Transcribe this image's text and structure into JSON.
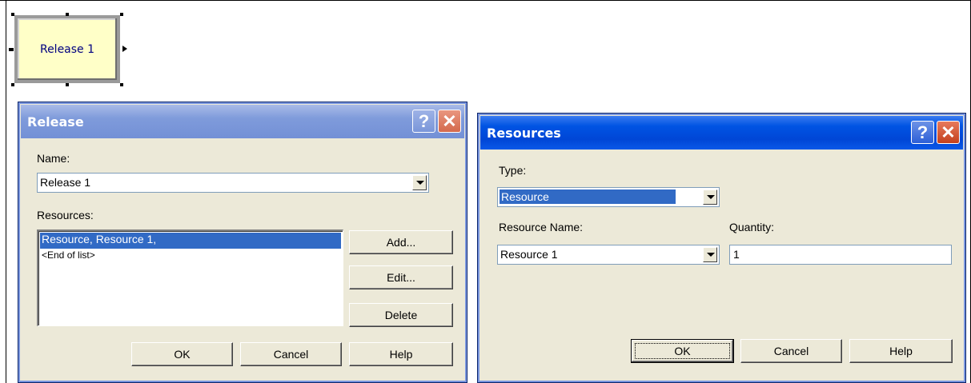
{
  "module": {
    "label": "Release 1"
  },
  "release_dialog": {
    "title": "Release",
    "name_label": "Name:",
    "name_value": "Release 1",
    "resources_label": "Resources:",
    "resources_items": [
      "Resource, Resource 1,",
      "<End of list>"
    ],
    "buttons": {
      "add": "Add...",
      "edit": "Edit...",
      "delete": "Delete",
      "ok": "OK",
      "cancel": "Cancel",
      "help": "Help"
    }
  },
  "resources_dialog": {
    "title": "Resources",
    "type_label": "Type:",
    "type_value": "Resource",
    "resource_name_label": "Resource Name:",
    "resource_name_value": "Resource 1",
    "quantity_label": "Quantity:",
    "quantity_value": "1",
    "buttons": {
      "ok": "OK",
      "cancel": "Cancel",
      "help": "Help"
    }
  },
  "titlebar_glyphs": {
    "help": "?",
    "close": "✕"
  },
  "colors": {
    "active_titlebar": "#0054e3",
    "inactive_titlebar": "#7f9bdb",
    "selection": "#316ac5",
    "dialog_face": "#ece9d8",
    "module_fill": "#ffffc8"
  }
}
